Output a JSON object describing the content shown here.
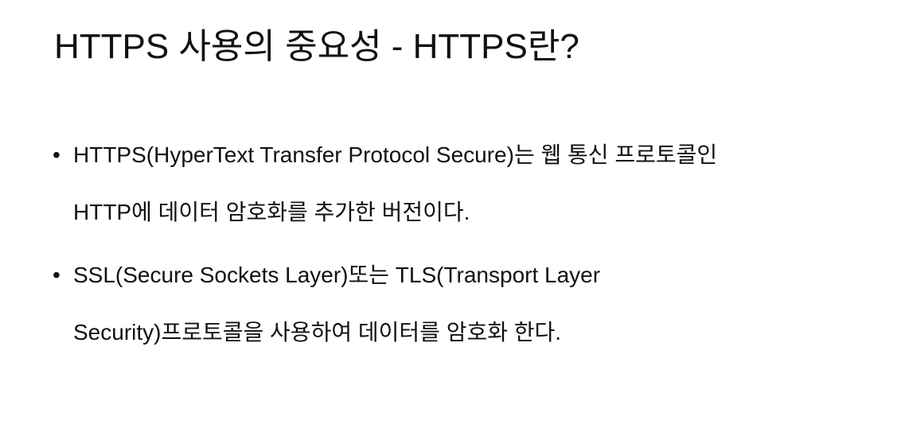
{
  "slide": {
    "title": "HTTPS 사용의 중요성 - HTTPS란?",
    "bullets": [
      {
        "marker": "•",
        "line1": "HTTPS(HyperText Transfer Protocol Secure)는 웹 통신 프로토콜인",
        "line2": "HTTP에 데이터 암호화를 추가한 버전이다."
      },
      {
        "marker": "•",
        "line1": "SSL(Secure Sockets Layer)또는 TLS(Transport Layer",
        "line2": "Security)프로토콜을 사용하여 데이터를 암호화 한다."
      }
    ]
  }
}
